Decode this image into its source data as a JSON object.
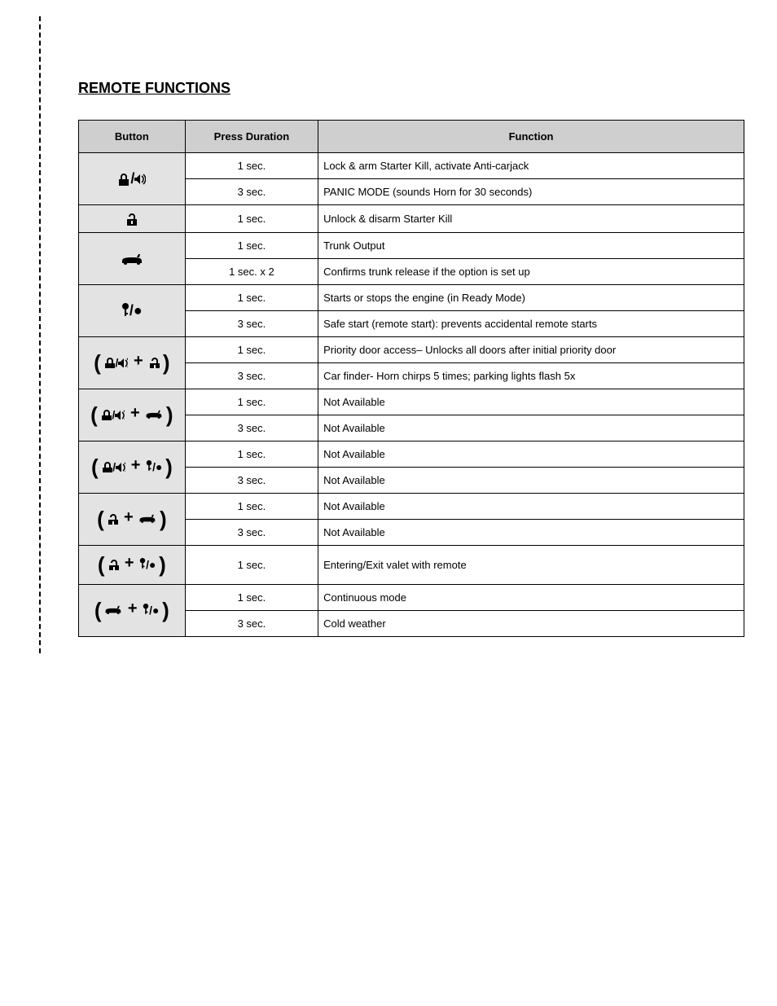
{
  "title": "REMOTE FUNCTIONS",
  "headers": {
    "button": "Button",
    "duration": "Press Duration",
    "function": "Function"
  },
  "rows": [
    {
      "button_icon": "lock_sound",
      "duration": "1 sec.",
      "function": "Lock & arm Starter Kill, activate Anti-carjack"
    },
    {
      "button_icon": "",
      "duration": "3 sec.",
      "function": "PANIC MODE (sounds Horn for 30 seconds)"
    },
    {
      "button_icon": "unlock",
      "duration": "1 sec.",
      "function": "Unlock & disarm Starter Kill"
    },
    {
      "button_icon": "car",
      "duration": "1 sec.",
      "function": "Trunk Output"
    },
    {
      "button_icon": "",
      "duration": "1 sec. x 2",
      "function": "Confirms trunk release if the option is set up"
    },
    {
      "button_icon": "key",
      "duration": "1 sec.",
      "function": "Starts or stops the engine (in Ready Mode)"
    },
    {
      "button_icon": "",
      "duration": "3 sec.",
      "function": "Safe start (remote start): prevents accidental remote starts"
    },
    {
      "button_icon": "lock_sound_unlock",
      "duration": "1 sec.",
      "function": "Priority door access– Unlocks all doors after initial priority door"
    },
    {
      "button_icon": "",
      "duration": "3 sec.",
      "function": "Car finder- Horn chirps 5 times; parking lights flash 5x"
    },
    {
      "button_icon": "lock_sound_car",
      "duration": "1 sec.",
      "function": "Not Available"
    },
    {
      "button_icon": "",
      "duration": "3 sec.",
      "function": "Not Available"
    },
    {
      "button_icon": "lock_sound_key",
      "duration": "1 sec.",
      "function": "Not Available"
    },
    {
      "button_icon": "",
      "duration": "3 sec.",
      "function": "Not Available"
    },
    {
      "button_icon": "unlock_car",
      "duration": "1 sec.",
      "function": "Not Available"
    },
    {
      "button_icon": "",
      "duration": "3 sec.",
      "function": "Not Available"
    },
    {
      "button_icon": "unlock_key",
      "duration": "1 sec.",
      "function": "Entering/Exit valet with remote"
    },
    {
      "button_icon": "car_key",
      "duration": "1 sec.",
      "function": "Continuous mode"
    },
    {
      "button_icon": "",
      "duration": "3 sec.",
      "function": "Cold weather"
    }
  ]
}
